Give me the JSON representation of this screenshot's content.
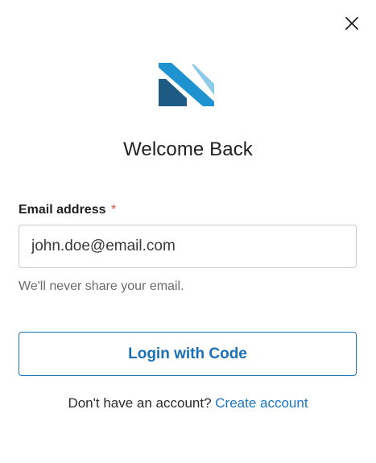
{
  "dialog": {
    "close_icon": "close-icon",
    "logo_icon": "brand-logo-icon",
    "title": "Welcome Back"
  },
  "email": {
    "label": "Email address",
    "required_mark": "*",
    "value": "john.doe@email.com",
    "placeholder": "",
    "helper": "We'll never share your email."
  },
  "actions": {
    "login_label": "Login with Code"
  },
  "footer": {
    "prompt": "Don't have an account?",
    "link_label": "Create account"
  },
  "colors": {
    "accent": "#1a6fb5",
    "link": "#1a73c4",
    "required": "#e0533d",
    "logo_dark": "#1d5b85",
    "logo_mid": "#1f93d0",
    "logo_light": "#8ccbe8"
  }
}
